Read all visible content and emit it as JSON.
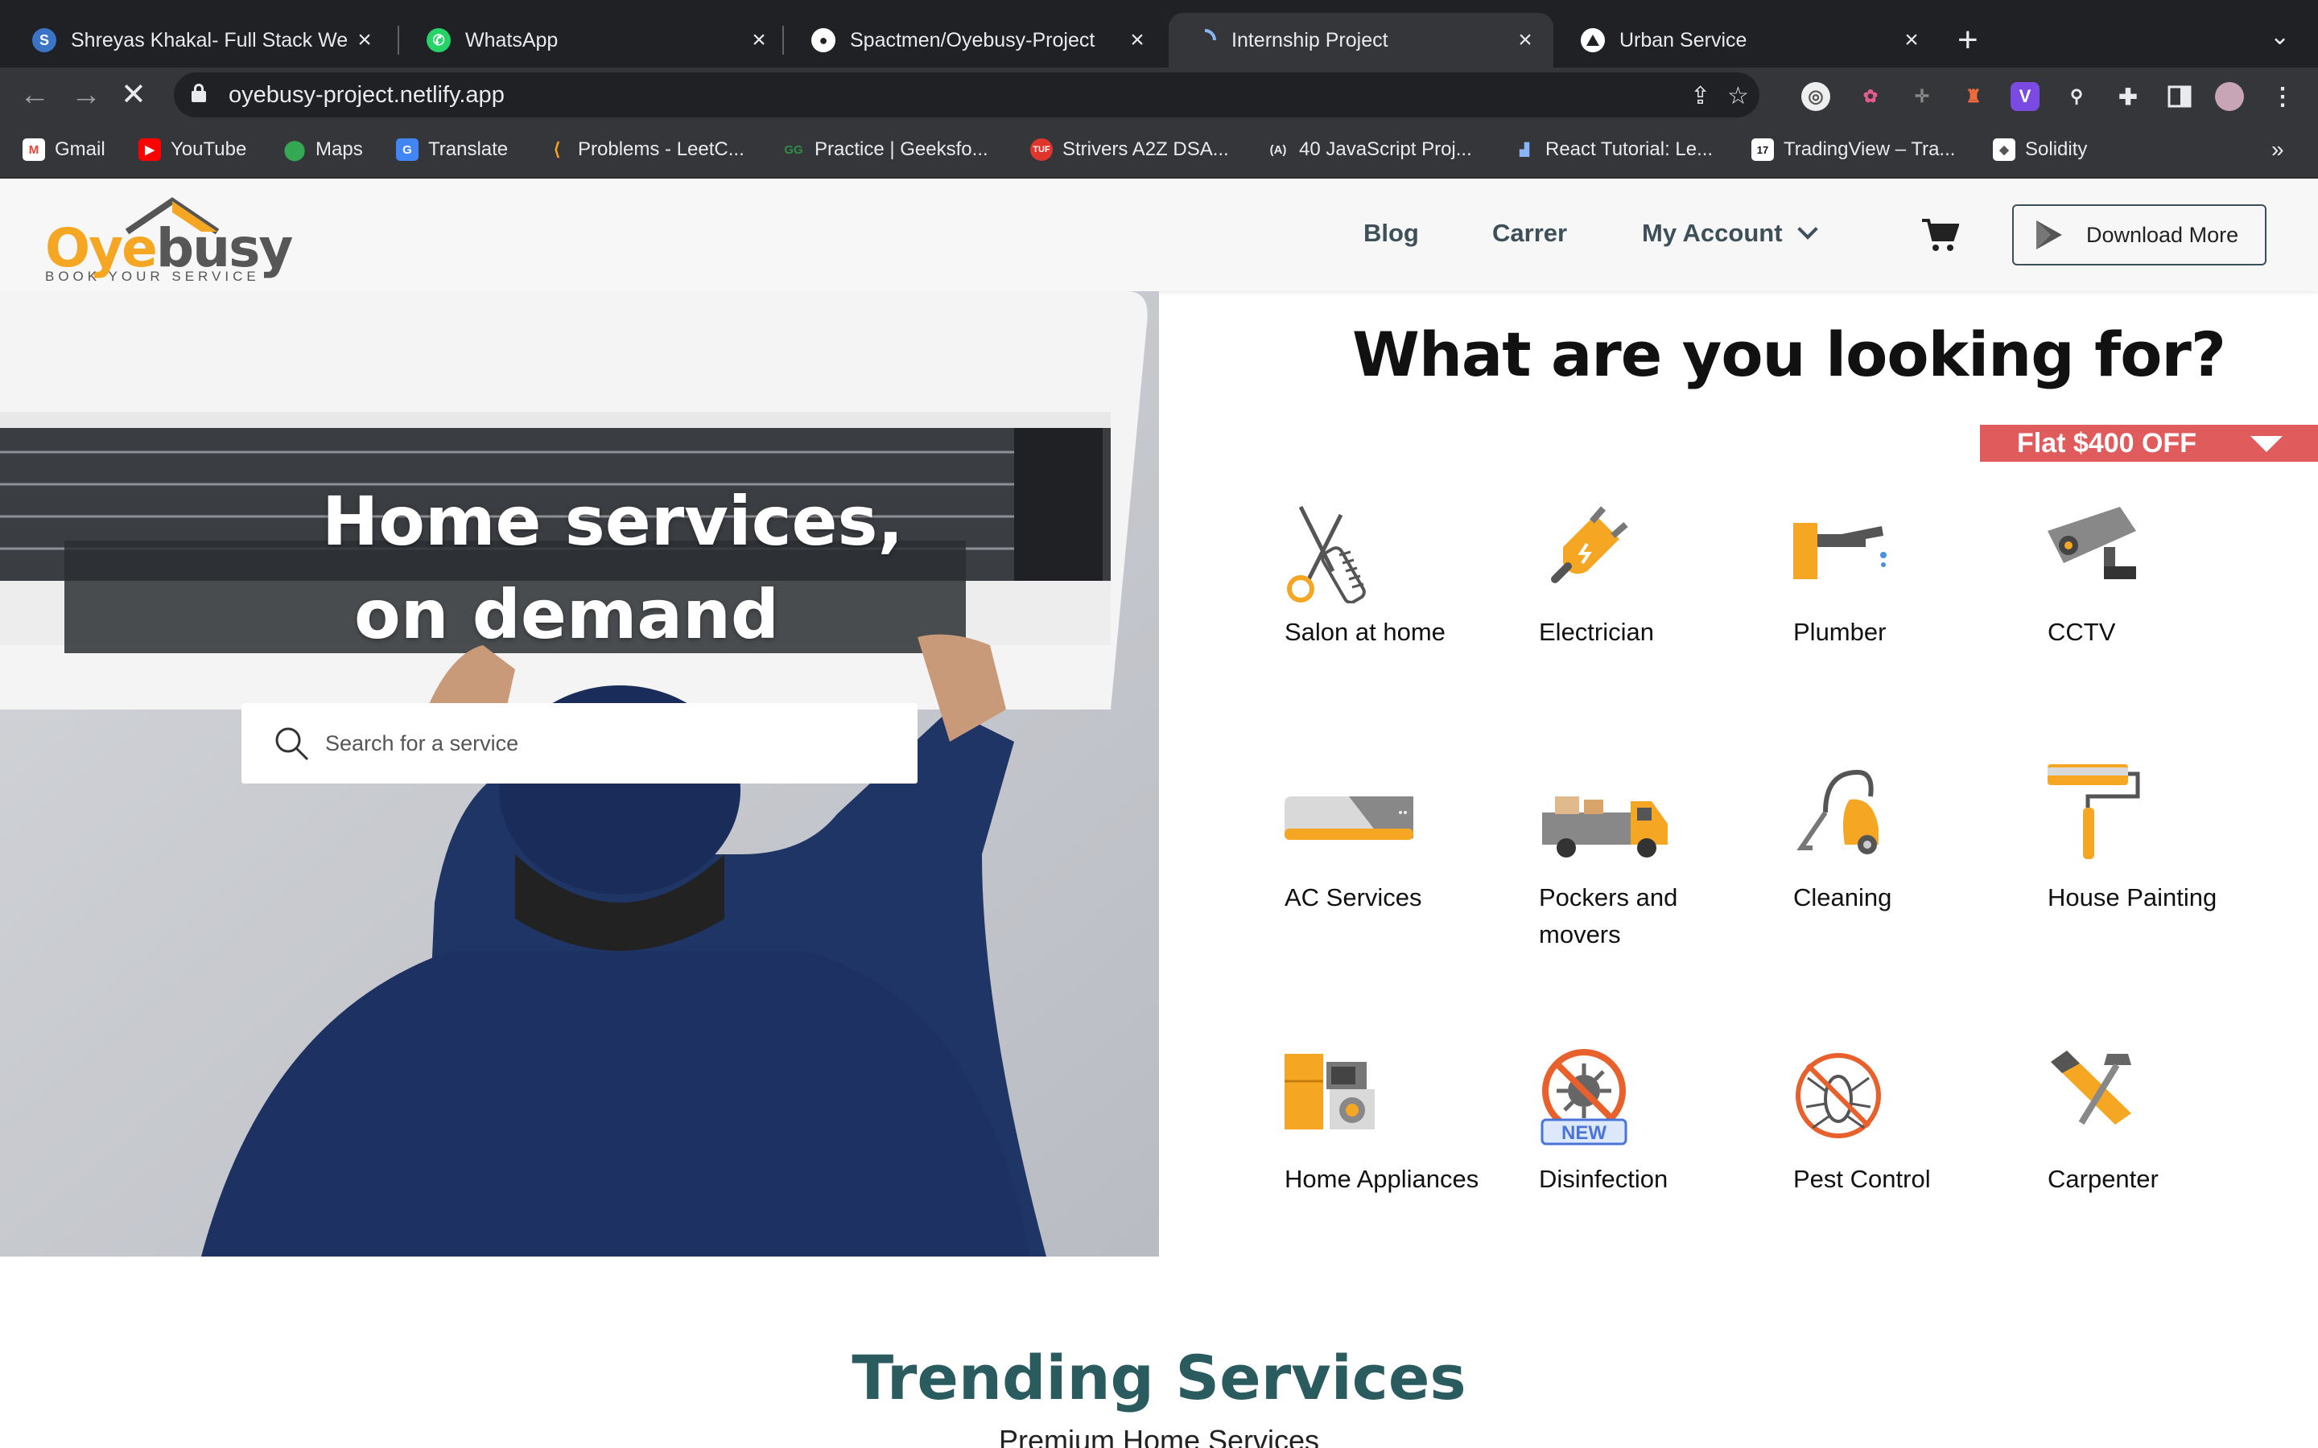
{
  "browser": {
    "tabs": [
      {
        "title": "Shreyas Khakal- Full Stack We",
        "favicon": "S",
        "color": "#3b73c6"
      },
      {
        "title": "WhatsApp",
        "favicon": "whatsapp-icon",
        "color": "#25d366"
      },
      {
        "title": "Spactmen/Oyebusy-Project",
        "favicon": "github-icon",
        "color": "#ffffff"
      },
      {
        "title": "Internship Project",
        "favicon": "loading-icon",
        "color": "#8ab4f8"
      },
      {
        "title": "Urban Service",
        "favicon": "triangle-icon",
        "color": "#ffffff"
      }
    ],
    "active_tab": 3,
    "url": "oyebusy-project.netlify.app",
    "bookmarks": [
      {
        "label": "Gmail",
        "color": "#ea4335",
        "glyph": "M"
      },
      {
        "label": "YouTube",
        "color": "#ff0000",
        "glyph": "▶"
      },
      {
        "label": "Maps",
        "color": "#34a853",
        "glyph": "●"
      },
      {
        "label": "Translate",
        "color": "#4285f4",
        "glyph": "G"
      },
      {
        "label": "Problems - LeetC...",
        "color": "#f89f1b",
        "glyph": "L"
      },
      {
        "label": "Practice | Geeksfo...",
        "color": "#2f8d46",
        "glyph": "G"
      },
      {
        "label": "Strivers A2Z DSA...",
        "color": "#e0352b",
        "glyph": "T"
      },
      {
        "label": "40 JavaScript Proj...",
        "color": "#111111",
        "glyph": "A"
      },
      {
        "label": "React Tutorial: Le...",
        "color": "#4a6cf7",
        "glyph": "R"
      },
      {
        "label": "TradingView – Tra...",
        "color": "#131722",
        "glyph": "TV"
      },
      {
        "label": "Solidity",
        "color": "#888888",
        "glyph": "◆"
      }
    ]
  },
  "site": {
    "logo": {
      "part1": "Oye",
      "part2": "busy",
      "tagline": "BOOK YOUR SERVICE"
    },
    "nav": {
      "blog": "Blog",
      "career": "Carrer",
      "account": "My Account"
    },
    "download_label": "Download More",
    "hero": {
      "line1": "Home services,",
      "line2": "on demand",
      "search_placeholder": "Search for a service"
    },
    "panel_title": "What are you looking for?",
    "offer": "Flat $400 OFF",
    "services": [
      {
        "label": "Salon at home",
        "icon": "scissors-comb-icon"
      },
      {
        "label": "Electrician",
        "icon": "plug-icon"
      },
      {
        "label": "Plumber",
        "icon": "faucet-icon"
      },
      {
        "label": "CCTV",
        "icon": "cctv-camera-icon"
      },
      {
        "label": "AC Services",
        "icon": "air-conditioner-icon"
      },
      {
        "label": "Pockers and movers",
        "icon": "truck-icon"
      },
      {
        "label": "Cleaning",
        "icon": "vacuum-icon"
      },
      {
        "label": "House Painting",
        "icon": "paint-roller-icon"
      },
      {
        "label": "Home Appliances",
        "icon": "appliances-icon"
      },
      {
        "label": "Disinfection",
        "icon": "virus-icon",
        "badge": "NEW"
      },
      {
        "label": "Pest Control",
        "icon": "pest-icon"
      },
      {
        "label": "Carpenter",
        "icon": "saw-hammer-icon"
      }
    ],
    "trending": {
      "title": "Trending Services",
      "subtitle": "Premium Home Services"
    }
  },
  "colors": {
    "brand_orange": "#f5a623",
    "offer_red": "#e05c5c",
    "heading_teal": "#2a5b5e",
    "nav_text": "#3d4f58"
  }
}
